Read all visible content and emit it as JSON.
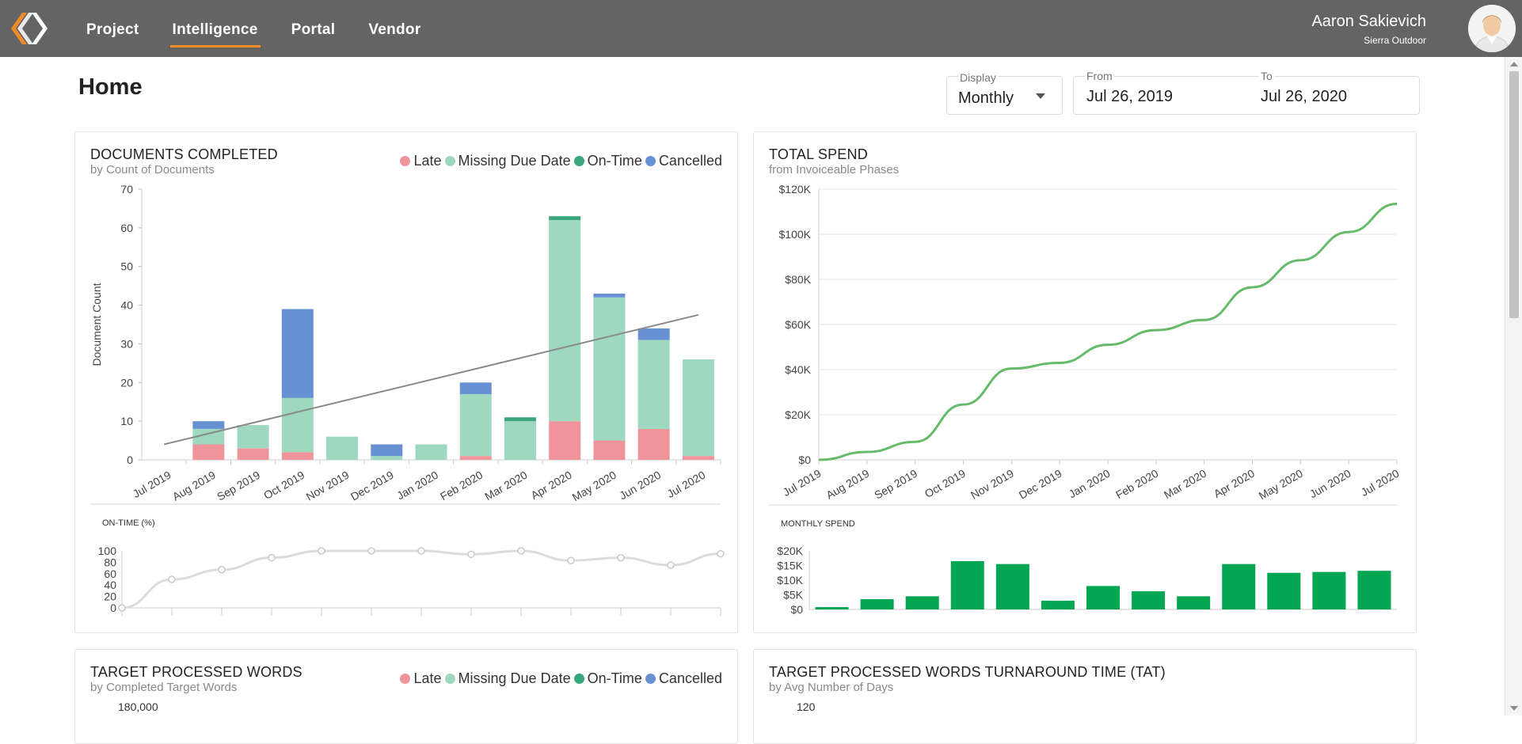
{
  "app": {
    "logo_icon": "company-chevron-logo-icon"
  },
  "nav": {
    "items": [
      {
        "label": "Project",
        "active": false
      },
      {
        "label": "Intelligence",
        "active": true
      },
      {
        "label": "Portal",
        "active": false
      },
      {
        "label": "Vendor",
        "active": false
      }
    ]
  },
  "user": {
    "name": "Aaron Sakievich",
    "org": "Sierra Outdoor",
    "avatar_icon": "user-avatar-icon"
  },
  "page": {
    "title": "Home"
  },
  "filters": {
    "display_label": "Display",
    "display_value": "Monthly",
    "from_label": "From",
    "from_value": "Jul 26, 2019",
    "to_label": "To",
    "to_value": "Jul 26, 2020"
  },
  "colors": {
    "late": "#f0949c",
    "missing": "#9dd8bf",
    "ontime": "#3aa77a",
    "cancelled": "#6891d4",
    "spend": "#66bb6a",
    "monthly": "#00a651",
    "trend": "#8a8a8a",
    "ontime_line": "#dcdcdc",
    "topbar": "#646464",
    "accent": "#f08a24"
  },
  "legend": {
    "late": "Late",
    "missing": "Missing Due Date",
    "ontime": "On-Time",
    "cancelled": "Cancelled"
  },
  "cards": {
    "documents": {
      "title": "DOCUMENTS COMPLETED",
      "subtitle": "by Count of Documents",
      "sub_title": "ON-TIME (%)"
    },
    "spend": {
      "title": "TOTAL SPEND",
      "subtitle": "from Invoiceable Phases",
      "sub_title": "MONTHLY SPEND"
    },
    "target_words": {
      "title": "TARGET PROCESSED WORDS",
      "subtitle": "by Completed Target Words",
      "y_top_tick": "180,000"
    },
    "tat": {
      "title": "TARGET PROCESSED WORDS TURNAROUND TIME (TAT)",
      "subtitle": "by Avg Number of Days",
      "y_top_tick": "120"
    }
  },
  "chart_data": [
    {
      "type": "bar",
      "title": "DOCUMENTS COMPLETED",
      "subtitle": "by Count of Documents",
      "ylabel": "Document Count",
      "ylim": [
        0,
        70
      ],
      "yticks": [
        0,
        10,
        20,
        30,
        40,
        50,
        60,
        70
      ],
      "grid": true,
      "legend_position": "top-right",
      "stacked": true,
      "categories": [
        "Jul 2019",
        "Aug 2019",
        "Sep 2019",
        "Oct 2019",
        "Nov 2019",
        "Dec 2019",
        "Jan 2020",
        "Feb 2020",
        "Mar 2020",
        "Apr 2020",
        "May 2020",
        "Jun 2020",
        "Jul 2020"
      ],
      "series": [
        {
          "name": "Late",
          "values": [
            0,
            4,
            3,
            2,
            0,
            0,
            0,
            1,
            0,
            10,
            5,
            8,
            1
          ]
        },
        {
          "name": "Missing Due Date",
          "values": [
            0,
            4,
            6,
            14,
            6,
            1,
            4,
            16,
            10,
            52,
            37,
            23,
            25
          ]
        },
        {
          "name": "On-Time",
          "values": [
            0,
            0,
            0,
            0,
            0,
            0,
            0,
            0,
            1,
            1,
            0,
            0,
            0
          ]
        },
        {
          "name": "Cancelled",
          "values": [
            0,
            2,
            0,
            23,
            0,
            3,
            0,
            3,
            0,
            0,
            1,
            3,
            0
          ]
        }
      ],
      "trendline": {
        "start": 4,
        "end": 37.5
      }
    },
    {
      "type": "line",
      "title": "ON-TIME (%)",
      "ylim": [
        0,
        100
      ],
      "yticks": [
        0,
        20,
        40,
        60,
        80,
        100
      ],
      "x": [
        "Jul 2019",
        "Aug 2019",
        "Sep 2019",
        "Oct 2019",
        "Nov 2019",
        "Dec 2019",
        "Jan 2020",
        "Feb 2020",
        "Mar 2020",
        "Apr 2020",
        "May 2020",
        "Jun 2020",
        "Jul 2020"
      ],
      "values": [
        0,
        50,
        67,
        88,
        100,
        100,
        100,
        94,
        100,
        83,
        88,
        75,
        95
      ]
    },
    {
      "type": "line",
      "title": "TOTAL SPEND",
      "subtitle": "from Invoiceable Phases",
      "ylim": [
        0,
        120000
      ],
      "yticks": [
        0,
        20000,
        40000,
        60000,
        80000,
        100000,
        120000
      ],
      "ytick_labels": [
        "$0",
        "$20K",
        "$40K",
        "$60K",
        "$80K",
        "$100K",
        "$120K"
      ],
      "grid": true,
      "x": [
        "Jul 2019",
        "Aug 2019",
        "Sep 2019",
        "Oct 2019",
        "Nov 2019",
        "Dec 2019",
        "Jan 2020",
        "Feb 2020",
        "Mar 2020",
        "Apr 2020",
        "May 2020",
        "Jun 2020",
        "Jul 2020"
      ],
      "values": [
        0,
        3500,
        8000,
        24500,
        40500,
        43000,
        51000,
        57500,
        62000,
        76500,
        88500,
        101000,
        113500
      ]
    },
    {
      "type": "bar",
      "title": "MONTHLY SPEND",
      "ylim": [
        0,
        20000
      ],
      "yticks": [
        0,
        5000,
        10000,
        15000,
        20000
      ],
      "ytick_labels": [
        "$0",
        "$5K",
        "$10K",
        "$15K",
        "$20K"
      ],
      "categories": [
        "Jul 2019",
        "Aug 2019",
        "Sep 2019",
        "Oct 2019",
        "Nov 2019",
        "Dec 2019",
        "Jan 2020",
        "Feb 2020",
        "Mar 2020",
        "Apr 2020",
        "May 2020",
        "Jun 2020",
        "Jul 2020"
      ],
      "values": [
        800,
        3500,
        4500,
        16500,
        15500,
        3000,
        8000,
        6200,
        4500,
        15500,
        12500,
        12800,
        13200
      ]
    }
  ]
}
